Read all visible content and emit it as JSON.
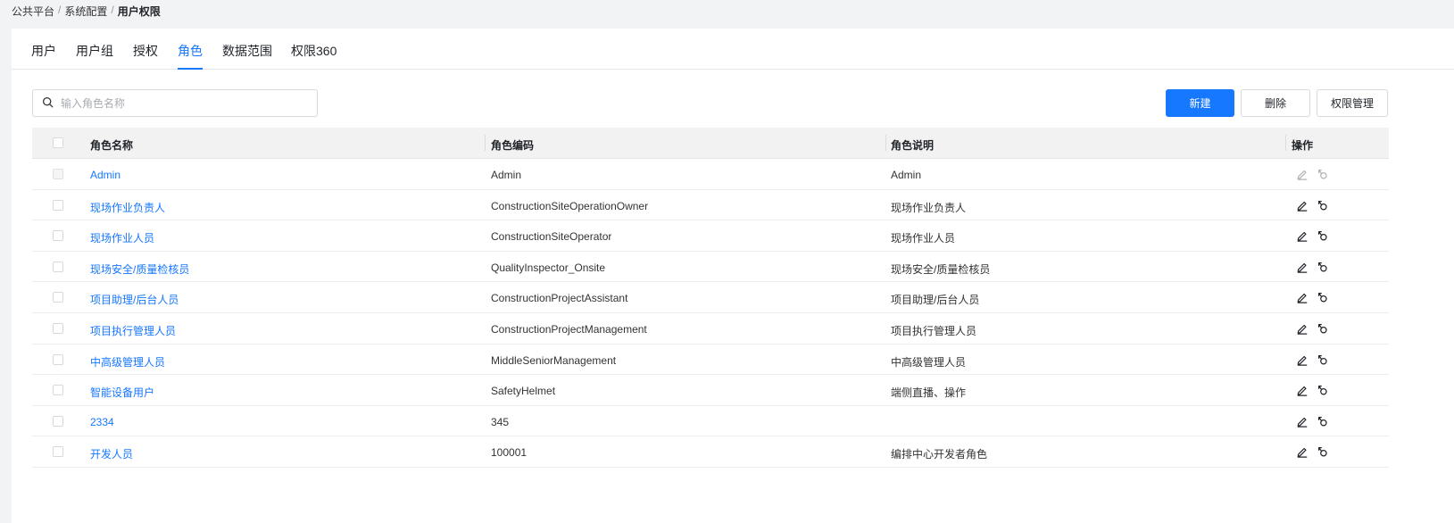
{
  "breadcrumb": [
    "公共平台",
    "系统配置",
    "用户权限"
  ],
  "tabs": [
    {
      "label": "用户"
    },
    {
      "label": "用户组"
    },
    {
      "label": "授权"
    },
    {
      "label": "角色",
      "active": true
    },
    {
      "label": "数据范围"
    },
    {
      "label": "权限360"
    }
  ],
  "search": {
    "placeholder": "输入角色名称",
    "value": "",
    "icon": "search-icon"
  },
  "toolbar": {
    "new_label": "新建",
    "delete_label": "删除",
    "perm_label": "权限管理"
  },
  "colors": {
    "accent": "#1677ff"
  },
  "table": {
    "headers": [
      "角色名称",
      "角色编码",
      "角色说明",
      "操作"
    ],
    "row_icons": [
      "edit-icon",
      "assign-icon"
    ],
    "rows": [
      {
        "name": "Admin",
        "code": "Admin",
        "desc": "Admin",
        "disabled": true
      },
      {
        "name": "现场作业负责人",
        "code": "ConstructionSiteOperationOwner",
        "desc": "现场作业负责人"
      },
      {
        "name": "现场作业人员",
        "code": "ConstructionSiteOperator",
        "desc": "现场作业人员"
      },
      {
        "name": "现场安全/质量检核员",
        "code": "QualityInspector_Onsite",
        "desc": "现场安全/质量检核员"
      },
      {
        "name": "项目助理/后台人员",
        "code": "ConstructionProjectAssistant",
        "desc": "项目助理/后台人员"
      },
      {
        "name": "项目执行管理人员",
        "code": "ConstructionProjectManagement",
        "desc": "项目执行管理人员"
      },
      {
        "name": "中高级管理人员",
        "code": "MiddleSeniorManagement",
        "desc": "中高级管理人员"
      },
      {
        "name": "智能设备用户",
        "code": "SafetyHelmet",
        "desc": "端侧直播、操作"
      },
      {
        "name": "2334",
        "code": "345",
        "desc": ""
      },
      {
        "name": "开发人员",
        "code": "100001",
        "desc": "编排中心开发者角色"
      }
    ]
  }
}
